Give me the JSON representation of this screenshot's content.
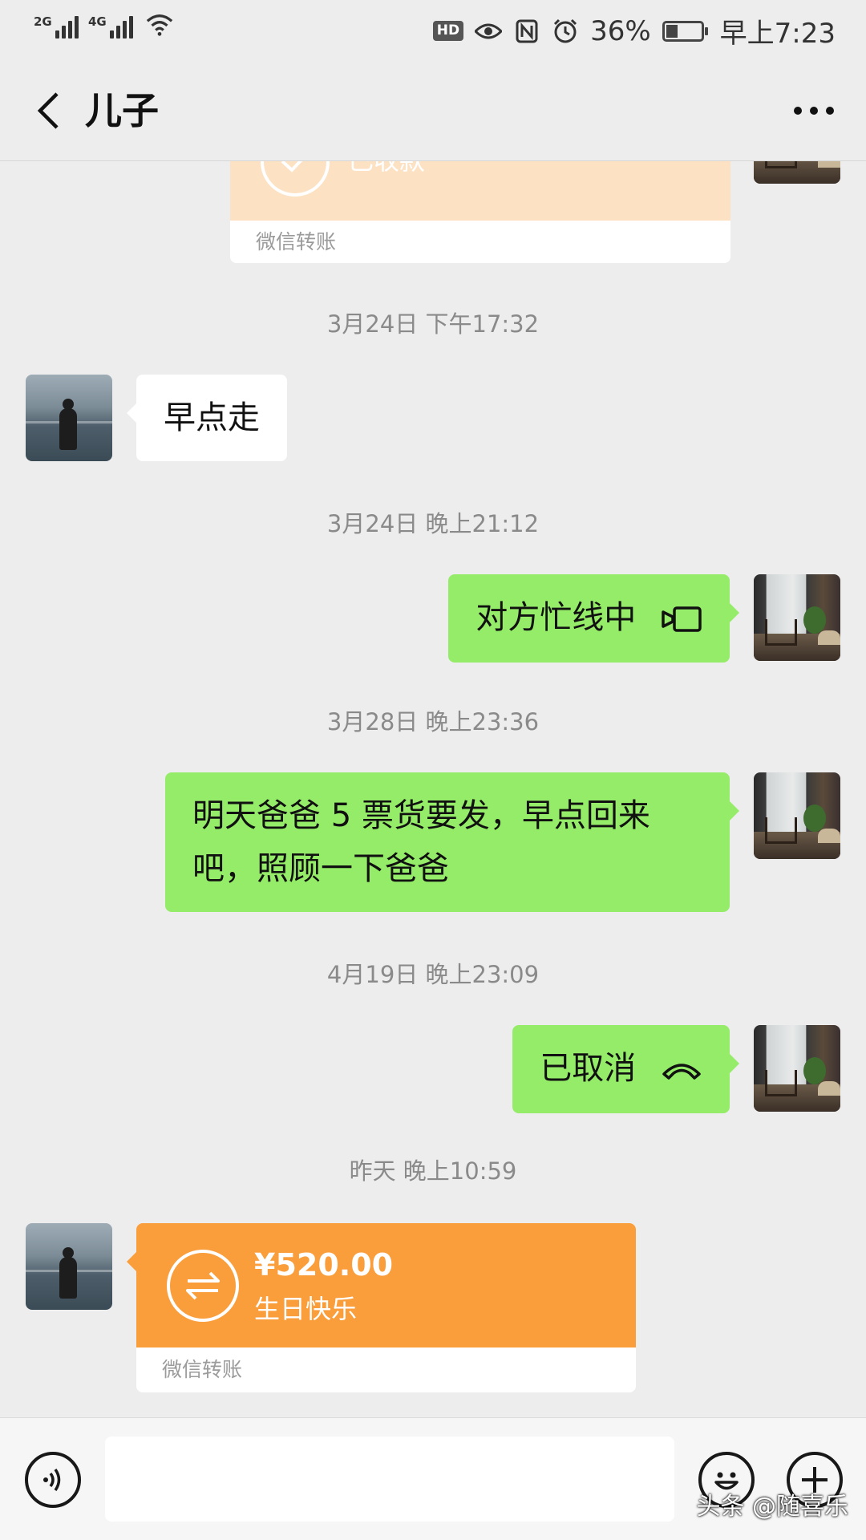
{
  "status_bar": {
    "network_1": "2G",
    "network_2": "4G",
    "hd": "HD",
    "battery_percent": "36%",
    "battery_level": 0.36,
    "time": "早上7:23"
  },
  "header": {
    "title": "儿子"
  },
  "messages": {
    "prev_transfer_status": "已收款",
    "prev_transfer_footer": "微信转账",
    "ts1": "3月24日 下午17:32",
    "msg1": "早点走",
    "ts2": "3月24日 晚上21:12",
    "msg2": "对方忙线中",
    "ts3": "3月28日 晚上23:36",
    "msg3_line1": "明天爸爸 5 票货要发，早点回来",
    "msg3_line2": "吧，照顾一下爸爸",
    "ts4": "4月19日 晚上23:09",
    "msg4": "已取消",
    "ts5": "昨天 晚上10:59",
    "transfer_amount": "¥520.00",
    "transfer_note": "生日快乐",
    "transfer_footer": "微信转账"
  },
  "input_bar": {
    "text_value": ""
  },
  "watermark": "头条 @随喜乐",
  "colors": {
    "background": "#ededed",
    "green_bubble": "#95ec69",
    "transfer_orange": "#fa9d3b",
    "transfer_received": "#fde1c3"
  }
}
